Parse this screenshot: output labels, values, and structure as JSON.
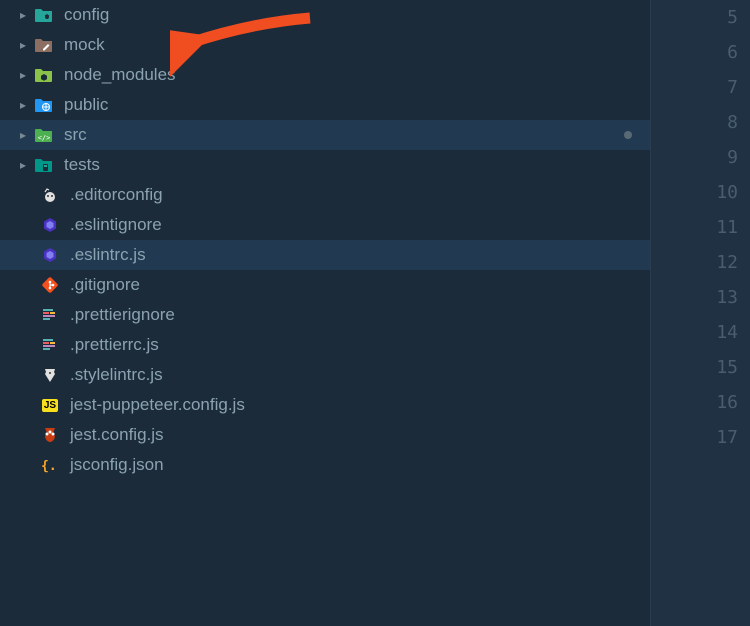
{
  "explorer": {
    "items": [
      {
        "type": "folder",
        "name": "config",
        "icon": "folder-config-icon",
        "expandable": true,
        "selected": false,
        "modified": false
      },
      {
        "type": "folder",
        "name": "mock",
        "icon": "folder-mock-icon",
        "expandable": true,
        "selected": false,
        "modified": false
      },
      {
        "type": "folder",
        "name": "node_modules",
        "icon": "folder-node-modules-icon",
        "expandable": true,
        "selected": false,
        "modified": false
      },
      {
        "type": "folder",
        "name": "public",
        "icon": "folder-public-icon",
        "expandable": true,
        "selected": false,
        "modified": false
      },
      {
        "type": "folder",
        "name": "src",
        "icon": "folder-src-icon",
        "expandable": true,
        "selected": true,
        "modified": true
      },
      {
        "type": "folder",
        "name": "tests",
        "icon": "folder-tests-icon",
        "expandable": true,
        "selected": false,
        "modified": false
      },
      {
        "type": "file",
        "name": ".editorconfig",
        "icon": "editorconfig-icon",
        "selected": false
      },
      {
        "type": "file",
        "name": ".eslintignore",
        "icon": "eslint-icon",
        "selected": false
      },
      {
        "type": "file",
        "name": ".eslintrc.js",
        "icon": "eslint-icon",
        "selected": true
      },
      {
        "type": "file",
        "name": ".gitignore",
        "icon": "git-icon",
        "selected": false
      },
      {
        "type": "file",
        "name": ".prettierignore",
        "icon": "prettier-icon",
        "selected": false
      },
      {
        "type": "file",
        "name": ".prettierrc.js",
        "icon": "prettier-icon",
        "selected": false
      },
      {
        "type": "file",
        "name": ".stylelintrc.js",
        "icon": "stylelint-icon",
        "selected": false
      },
      {
        "type": "file",
        "name": "jest-puppeteer.config.js",
        "icon": "js-icon",
        "selected": false
      },
      {
        "type": "file",
        "name": "jest.config.js",
        "icon": "jest-icon",
        "selected": false
      },
      {
        "type": "file",
        "name": "jsconfig.json",
        "icon": "jsconfig-icon",
        "selected": false
      }
    ]
  },
  "gutter": {
    "line_numbers": [
      "5",
      "6",
      "7",
      "8",
      "9",
      "10",
      "11",
      "12",
      "13",
      "14",
      "15",
      "16",
      "17"
    ]
  },
  "annotation": {
    "target_item": "mock",
    "arrow_color": "#f04d21"
  },
  "colors": {
    "bg": "#1b2b3a",
    "selected_bg": "#213a52",
    "text": "#8ba3b0",
    "gutter_bg": "#1f3142",
    "gutter_text": "#4a5d6e"
  }
}
